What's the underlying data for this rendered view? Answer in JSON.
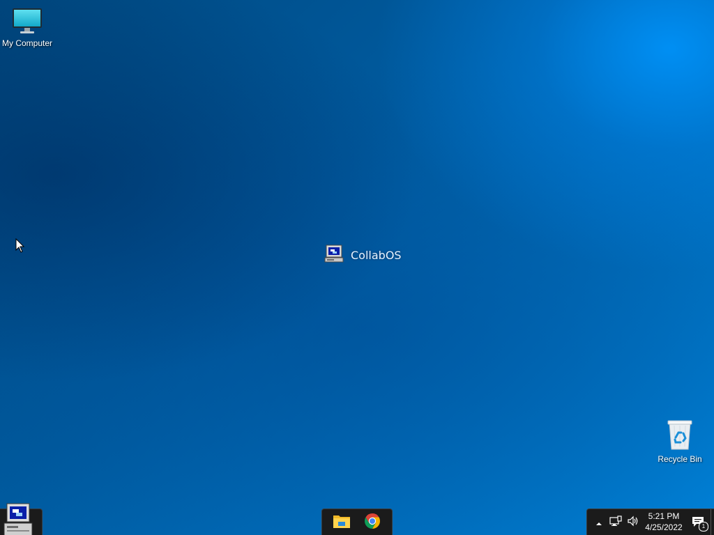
{
  "desktop": {
    "icons": [
      {
        "label": "My Computer",
        "icon": "monitor-icon"
      },
      {
        "label": "Recycle Bin",
        "icon": "recycle-bin-icon"
      }
    ],
    "center_logo": {
      "label": "CollabOS",
      "icon": "retro-computer-icon"
    }
  },
  "taskbar": {
    "start_icon": "retro-computer-icon",
    "pinned_apps": [
      {
        "name": "File Explorer",
        "icon": "folder-icon"
      },
      {
        "name": "Google Chrome",
        "icon": "chrome-icon"
      }
    ],
    "tray": {
      "overflow_icon": "chevron-up-icon",
      "network_icon": "network-icon",
      "volume_icon": "volume-icon",
      "time": "5:21 PM",
      "date": "4/25/2022",
      "notification_icon": "notification-icon",
      "notification_count": "1"
    }
  },
  "colors": {
    "taskbar": "#1b1b1b",
    "desktop_dark": "#00487f",
    "desktop_light": "#0080d6"
  }
}
